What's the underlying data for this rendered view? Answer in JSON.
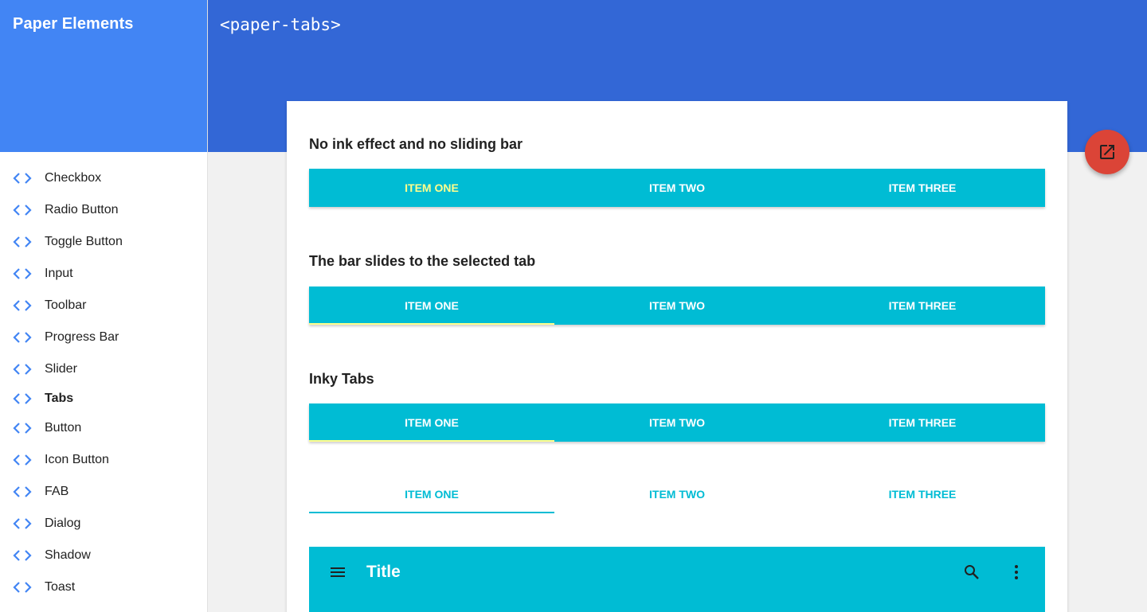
{
  "sidebar": {
    "title": "Paper Elements",
    "items": [
      {
        "label": "Checkbox"
      },
      {
        "label": "Radio Button"
      },
      {
        "label": "Toggle Button"
      },
      {
        "label": "Input"
      },
      {
        "label": "Toolbar"
      },
      {
        "label": "Progress Bar"
      },
      {
        "label": "Slider"
      },
      {
        "label": "Tabs"
      },
      {
        "label": "Button"
      },
      {
        "label": "Icon Button"
      },
      {
        "label": "FAB"
      },
      {
        "label": "Dialog"
      },
      {
        "label": "Shadow"
      },
      {
        "label": "Toast"
      }
    ],
    "active": "Tabs",
    "icon": "code-icon"
  },
  "header": {
    "title": "<paper-tabs>"
  },
  "fab": {
    "icon": "open-in-new-icon"
  },
  "sections": [
    {
      "title": "No ink effect and no sliding bar",
      "tabs": [
        "ITEM ONE",
        "ITEM TWO",
        "ITEM THREE"
      ],
      "selected": "ITEM ONE"
    },
    {
      "title": "The bar slides to the selected tab",
      "tabs": [
        "ITEM ONE",
        "ITEM TWO",
        "ITEM THREE"
      ],
      "selected": "ITEM ONE"
    },
    {
      "title": "Inky Tabs",
      "tabs": [
        "ITEM ONE",
        "ITEM TWO",
        "ITEM THREE"
      ],
      "selected": "ITEM ONE"
    },
    {
      "tabs": [
        "ITEM ONE",
        "ITEM TWO",
        "ITEM THREE"
      ],
      "selected": "ITEM ONE"
    }
  ],
  "toolbar": {
    "title": "Title",
    "left_icon": "menu-icon",
    "right_icons": [
      "search-icon",
      "more-vert-icon"
    ]
  },
  "colors": {
    "sidebar_header": "#4285f4",
    "header": "#3367d6",
    "tabs": "#00bcd4",
    "selected_text": "#ffff8d",
    "fab": "#db4437"
  }
}
